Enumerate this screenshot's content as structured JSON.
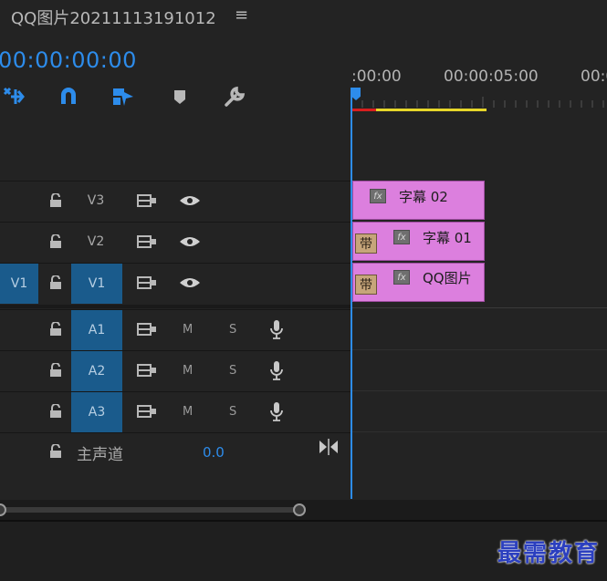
{
  "header": {
    "title": "QQ图片20211113191012",
    "menu_icon": "≡"
  },
  "timecode": "00:00:00:00",
  "ruler": {
    "labels": [
      ":00:00",
      "00:00:05:00",
      "00:0"
    ]
  },
  "tracks": {
    "v3": {
      "label": "V3"
    },
    "v2": {
      "label": "V2"
    },
    "v1": {
      "source": "V1",
      "label": "V1"
    },
    "a1": {
      "label": "A1",
      "mute": "M",
      "solo": "S"
    },
    "a2": {
      "label": "A2",
      "mute": "M",
      "solo": "S"
    },
    "a3": {
      "label": "A3",
      "mute": "M",
      "solo": "S"
    },
    "master": {
      "label": "主声道",
      "value": "0.0"
    }
  },
  "clips": [
    {
      "name": "字幕 02",
      "fx": "fx"
    },
    {
      "name": "字幕 01",
      "fx": "fx",
      "badge": "带"
    },
    {
      "name": "QQ图片",
      "fx": "fx",
      "badge": "带"
    }
  ],
  "watermark": "最需教育",
  "colors": {
    "accent": "#2d8ceb",
    "clip": "#dc7fde",
    "track_target": "#1a5b8c"
  }
}
